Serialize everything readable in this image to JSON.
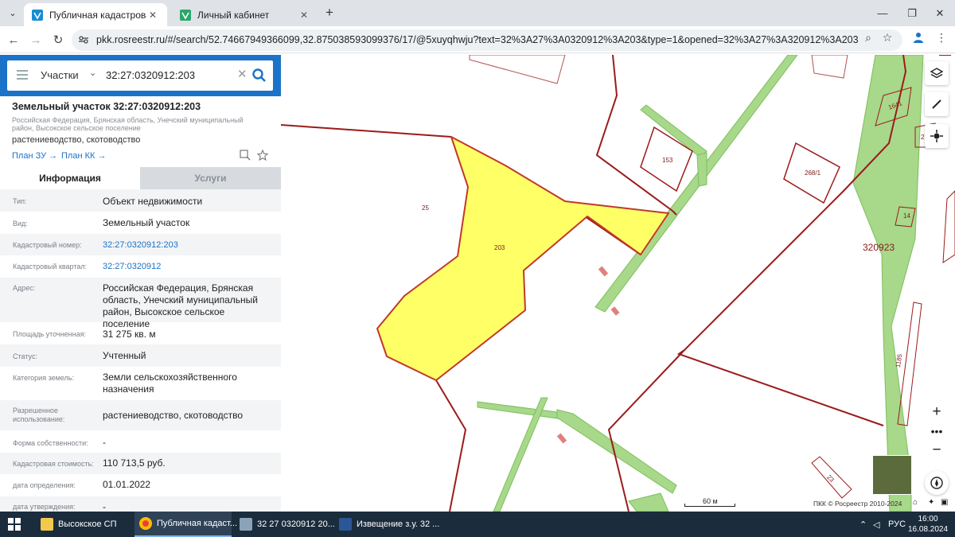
{
  "browser": {
    "tabs": [
      {
        "title": "Публичная кадастровая карта",
        "active": true
      },
      {
        "title": "Личный кабинет",
        "active": false
      }
    ],
    "url": "pkk.rosreestr.ru/#/search/52.74667949366099,32.875038593099376/17/@5xuyqhwju?text=32%3A27%3A0320912%3A203&type=1&opened=32%3A27%3A320912%3A203"
  },
  "search": {
    "category": "Участки",
    "value": "32:27:0320912:203"
  },
  "object": {
    "title": "Земельный участок 32:27:0320912:203",
    "address_short": "Российская Федерация, Брянская область, Унечский муниципальный район, Высокское сельское поселение",
    "use": "растениеводство, скотоводство",
    "plan_zu": "План ЗУ",
    "plan_kk": "План КК"
  },
  "tabs": {
    "info": "Информация",
    "services": "Услуги"
  },
  "rows": [
    {
      "label": "Тип:",
      "value": "Объект недвижимости"
    },
    {
      "label": "Вид:",
      "value": "Земельный участок"
    },
    {
      "label": "Кадастровый номер:",
      "value": "32:27:0320912:203"
    },
    {
      "label": "Кадастровый квартал:",
      "value": "32:27:0320912"
    },
    {
      "label": "Адрес:",
      "value": "Российская Федерация, Брянская область, Унечский муниципальный район, Высокское сельское поселение"
    },
    {
      "label": "Площадь уточненная:",
      "value": "31 275 кв. м"
    },
    {
      "label": "Статус:",
      "value": "Учтенный"
    },
    {
      "label": "Категория земель:",
      "value": "Земли сельскохозяйственного назначения"
    },
    {
      "label": "Разрешенное использование:",
      "value": "растениеводство, скотоводство"
    },
    {
      "label": "Форма собственности:",
      "value": "-"
    },
    {
      "label": "Кадастровая стоимость:",
      "value": "110 713,5 руб."
    },
    {
      "label": "дата определения:",
      "value": "01.01.2022"
    },
    {
      "label": "дата утверждения:",
      "value": "-"
    }
  ],
  "map": {
    "labels": {
      "p203": "203",
      "p25": "25",
      "p153": "153",
      "p268": "268/1",
      "p14": "14",
      "q320923": "320923",
      "p1641": "1641",
      "p1185": "1185",
      "p23": "23",
      "p2": "2"
    },
    "scale": "60 м",
    "copyright": "ПКК © Росреестр 2010-2024"
  },
  "taskbar": {
    "items": [
      {
        "label": "Высокское СП"
      },
      {
        "label": "Публичная кадаст..."
      },
      {
        "label": "32 27 0320912 20..."
      },
      {
        "label": "Извещение з.у. 32 ..."
      }
    ],
    "lang": "РУС",
    "time": "16:00",
    "date": "16.08.2024"
  }
}
